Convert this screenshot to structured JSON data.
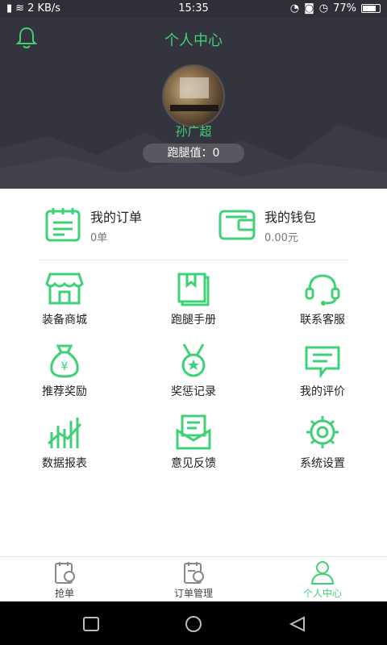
{
  "status_bar": {
    "net_speed": "2 KB/s",
    "time": "15:35",
    "battery": "77%"
  },
  "header": {
    "title": "个人中心",
    "username": "孙广超",
    "run_value": "跑腿值：0"
  },
  "summary": [
    {
      "title": "我的订单",
      "value": "0单"
    },
    {
      "title": "我的钱包",
      "value": "0.00元"
    }
  ],
  "menu": [
    {
      "label": "装备商城",
      "icon": "shop-icon"
    },
    {
      "label": "跑腿手册",
      "icon": "book-icon"
    },
    {
      "label": "联系客服",
      "icon": "headset-icon"
    },
    {
      "label": "推荐奖励",
      "icon": "money-bag-icon"
    },
    {
      "label": "奖惩记录",
      "icon": "medal-icon"
    },
    {
      "label": "我的评价",
      "icon": "comment-icon"
    },
    {
      "label": "数据报表",
      "icon": "chart-icon"
    },
    {
      "label": "意见反馈",
      "icon": "feedback-icon"
    },
    {
      "label": "系统设置",
      "icon": "gear-icon"
    }
  ],
  "tabs": [
    {
      "label": "抢单"
    },
    {
      "label": "订单管理"
    },
    {
      "label": "个人中心"
    }
  ],
  "colors": {
    "accent": "#3fd177",
    "header_bg": "#34343e"
  }
}
